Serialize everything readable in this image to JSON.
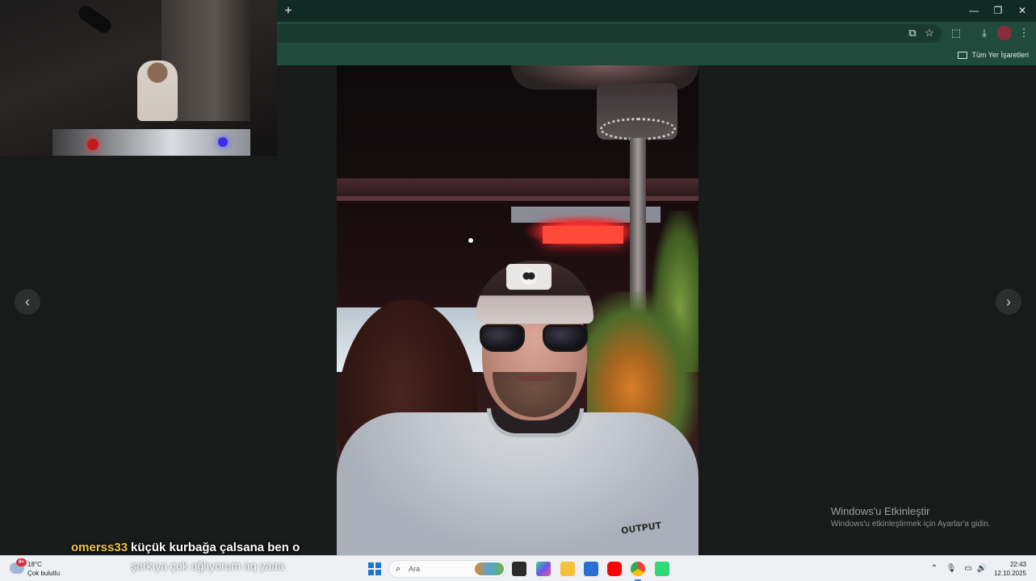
{
  "browser": {
    "new_tab_glyph": "+",
    "window_controls": {
      "minimize": "—",
      "maximize": "❐",
      "close": "✕"
    },
    "toolbar_icons": [
      "cast-icon",
      "star-icon",
      "extensions-icon",
      "download-icon",
      "profile-icon",
      "menu-icon"
    ],
    "bookmarks_bar": {
      "all_bookmarks_label": "Tüm Yer İşaretleri"
    },
    "colors": {
      "tabstrip": "#112a23",
      "toolbar": "#1f4a3c"
    }
  },
  "photo_viewer": {
    "prev_glyph": "‹",
    "next_glyph": "›",
    "shirt_logo_text": "OUTPUT"
  },
  "windows_watermark": {
    "title": "Windows'u Etkinleştir",
    "subtitle": "Windows'u etkinleştirmek için Ayarlar'a gidin."
  },
  "chat": {
    "username": "omerss33",
    "message_line1": "küçük kurbağa çalsana ben o",
    "message_line2": "şarkıya çok ağlıyorum aq yaaa",
    "username_color": "#f2c84a"
  },
  "taskbar": {
    "weather": {
      "badge": "9+",
      "temperature": "18°C",
      "condition": "Çok bulutlu"
    },
    "search_placeholder": "Ara",
    "apps": [
      "file-explorer",
      "copilot",
      "folders",
      "store",
      "youtube",
      "chrome",
      "app"
    ],
    "tray_icons": [
      "chevron-up-icon",
      "mic-icon",
      "monitor-icon",
      "volume-icon"
    ],
    "clock": {
      "time": "22:43",
      "date": "12.10.2025"
    }
  }
}
